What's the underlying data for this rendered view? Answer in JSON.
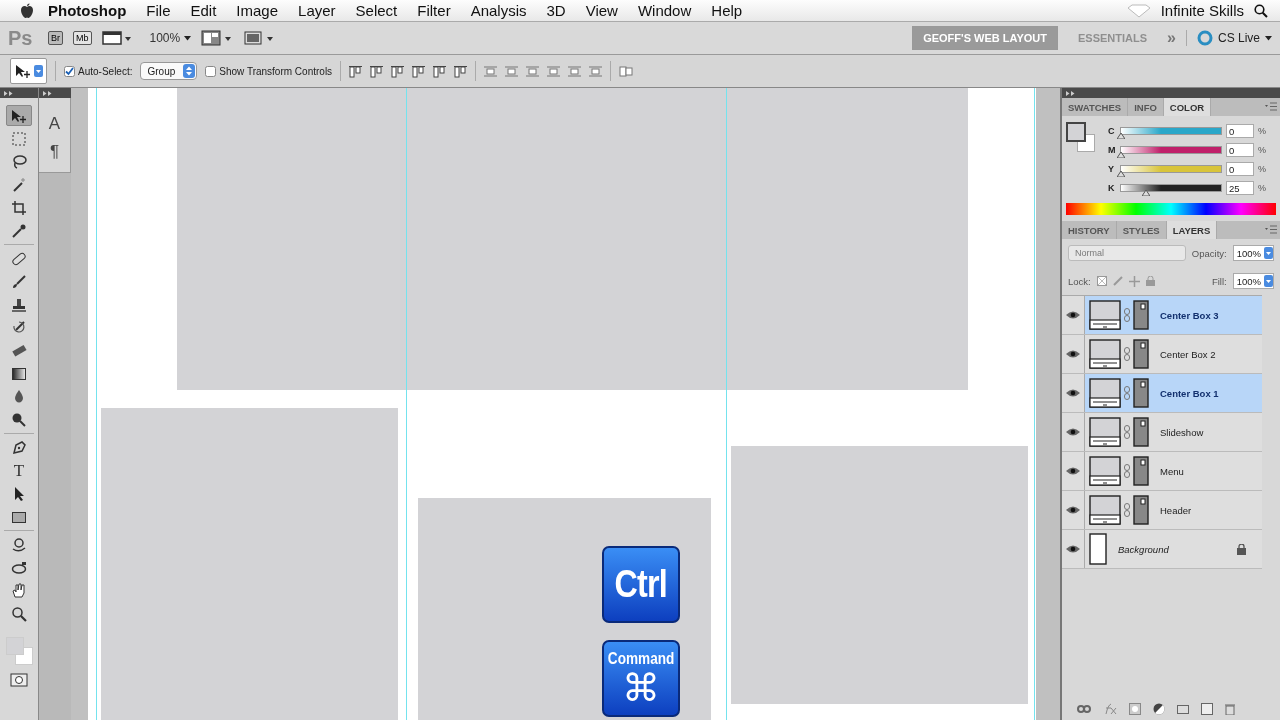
{
  "menu_bar": {
    "app_name": "Photoshop",
    "menus": [
      "File",
      "Edit",
      "Image",
      "Layer",
      "Select",
      "Filter",
      "Analysis",
      "3D",
      "View",
      "Window",
      "Help"
    ],
    "status_text": "Infinite Skills"
  },
  "app_bar": {
    "logo": "Ps",
    "bridge": "Br",
    "mini_bridge": "Mb",
    "zoom": "100%",
    "workspaces": [
      {
        "label": "GEOFF'S WEB LAYOUT",
        "selected": true
      },
      {
        "label": "ESSENTIALS",
        "selected": false
      }
    ],
    "more": "»",
    "cs_live": "CS Live"
  },
  "options_bar": {
    "auto_select": {
      "label": "Auto-Select:",
      "checked": true
    },
    "target": "Group",
    "transform_controls": {
      "label": "Show Transform Controls",
      "checked": false
    }
  },
  "tools": [
    {
      "kind": "move",
      "selected": true
    },
    {
      "kind": "marquee",
      "selected": false
    },
    {
      "kind": "lasso",
      "selected": false
    },
    {
      "kind": "wand",
      "selected": false
    },
    {
      "kind": "crop",
      "selected": false
    },
    {
      "kind": "eyedropper",
      "selected": false
    },
    {
      "kind": "heal",
      "selected": false
    },
    {
      "kind": "brush",
      "selected": false
    },
    {
      "kind": "stamp",
      "selected": false
    },
    {
      "kind": "history",
      "selected": false
    },
    {
      "kind": "eraser",
      "selected": false
    },
    {
      "kind": "gradient",
      "selected": false
    },
    {
      "kind": "blur",
      "selected": false
    },
    {
      "kind": "dodge",
      "selected": false
    },
    {
      "kind": "pen",
      "selected": false
    },
    {
      "kind": "type",
      "glyph": "T",
      "selected": false
    },
    {
      "kind": "path",
      "selected": false
    },
    {
      "kind": "shape",
      "selected": false
    },
    {
      "kind": "rotate3d",
      "selected": false
    },
    {
      "kind": "orbit3d",
      "selected": false
    },
    {
      "kind": "hand",
      "selected": false
    },
    {
      "kind": "zoom",
      "selected": false
    }
  ],
  "side_panel": {
    "character": "A",
    "paragraph": "¶"
  },
  "color_panel": {
    "tabs": [
      {
        "label": "SWATCHES",
        "selected": false
      },
      {
        "label": "INFO",
        "selected": false
      },
      {
        "label": "COLOR",
        "selected": true
      }
    ],
    "sliders": [
      {
        "name": "C",
        "level": 0,
        "value": "0",
        "unit": "%",
        "color": "#2aa7c9"
      },
      {
        "name": "M",
        "level": 0,
        "value": "0",
        "unit": "%",
        "color": "#c0206a"
      },
      {
        "name": "Y",
        "level": 0,
        "value": "0",
        "unit": "%",
        "color": "#d8c43a"
      },
      {
        "name": "K",
        "level": 0.25,
        "value": "25",
        "unit": "%",
        "color": "#222222"
      }
    ]
  },
  "layers_panel": {
    "tabs": [
      {
        "label": "HISTORY",
        "selected": false
      },
      {
        "label": "STYLES",
        "selected": false
      },
      {
        "label": "LAYERS",
        "selected": true
      }
    ],
    "blend_mode": {
      "value": "Normal",
      "disabled": true
    },
    "opacity_label": "Opacity:",
    "opacity": "100%",
    "lock_label": "Lock:",
    "fill_label": "Fill:",
    "fill": "100%",
    "layers": [
      {
        "name": "Center Box 3",
        "kind": "smart",
        "selected": true,
        "visible": true,
        "locked": false
      },
      {
        "name": "Center Box 2",
        "kind": "smart",
        "selected": false,
        "visible": true,
        "locked": false
      },
      {
        "name": "Center Box 1",
        "kind": "smart",
        "selected": true,
        "visible": true,
        "locked": false
      },
      {
        "name": "Slideshow",
        "kind": "smart",
        "selected": false,
        "visible": true,
        "locked": false
      },
      {
        "name": "Menu",
        "kind": "smart",
        "selected": false,
        "visible": true,
        "locked": false
      },
      {
        "name": "Header",
        "kind": "smart",
        "selected": false,
        "visible": true,
        "locked": false
      },
      {
        "name": "Background",
        "kind": "background",
        "selected": false,
        "visible": true,
        "locked": true
      }
    ]
  },
  "overlay_keys": [
    {
      "kind": "ctrl",
      "label": "Ctrl"
    },
    {
      "kind": "command",
      "label": "Command",
      "symbol": "⌘"
    }
  ]
}
